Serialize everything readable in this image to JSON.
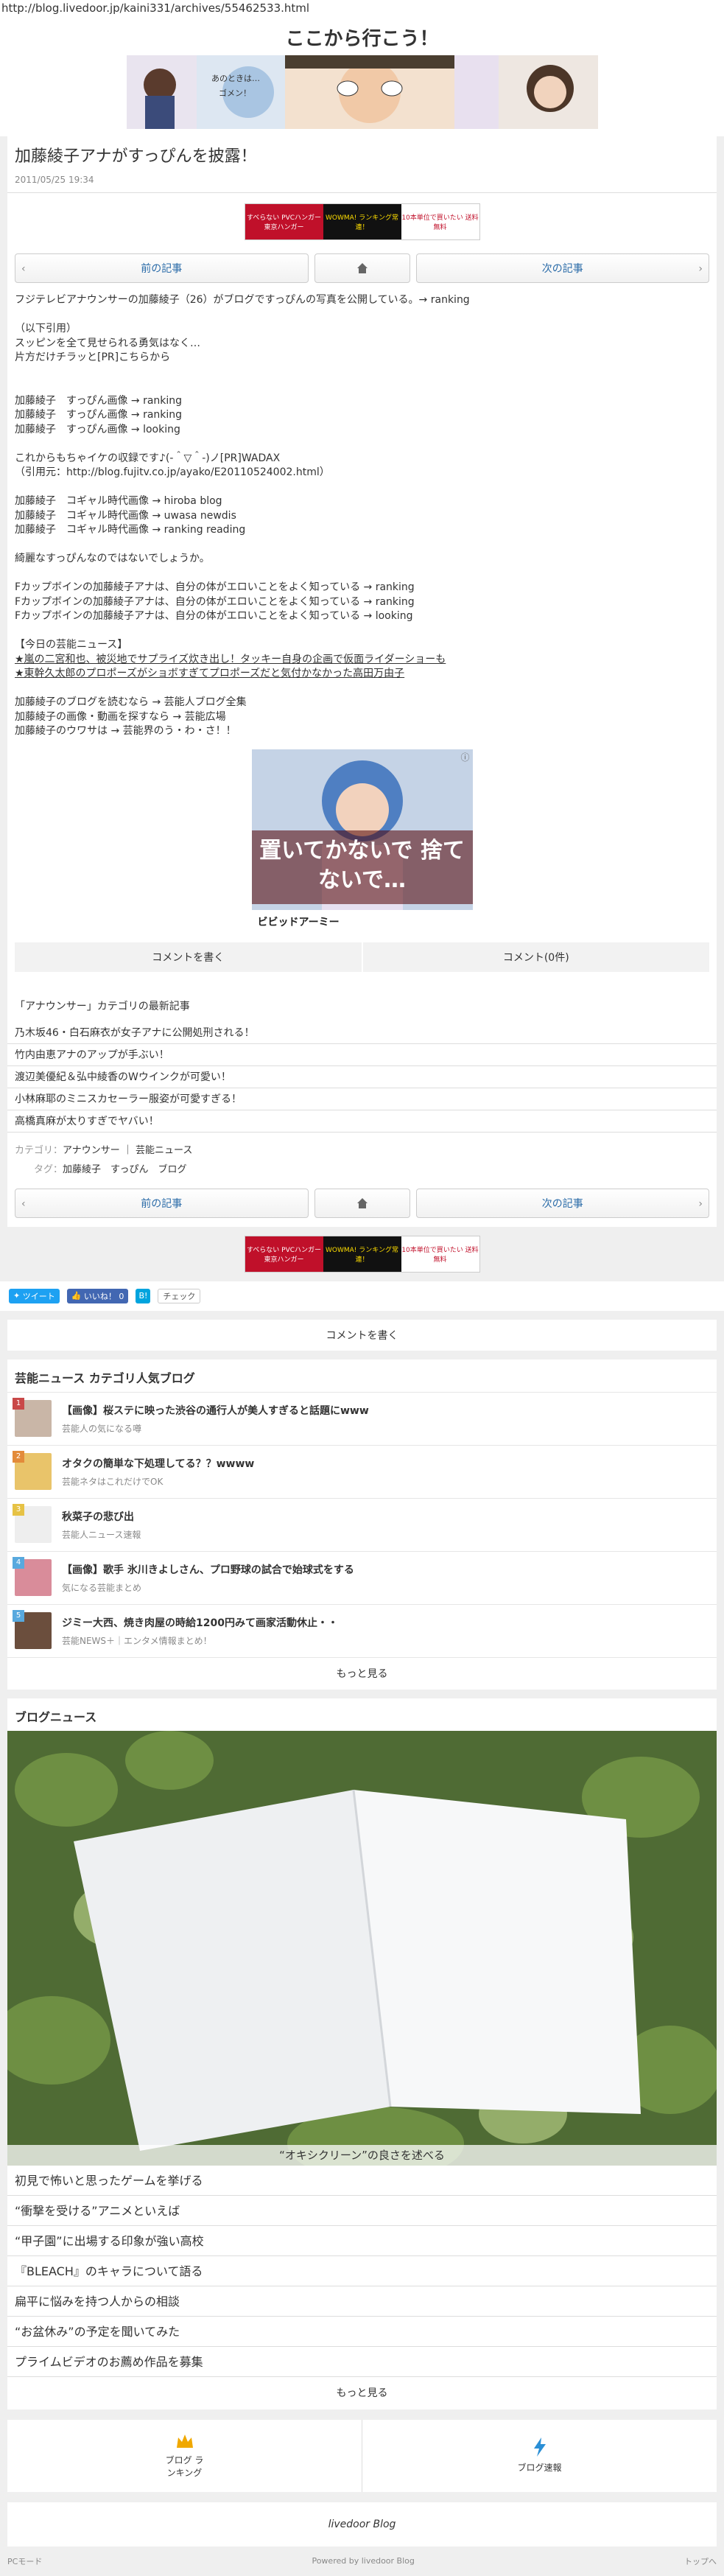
{
  "browser": {
    "url": "http://blog.livedoor.jp/kaini331/archives/55462533.html"
  },
  "site": {
    "title": "ここから行こう！"
  },
  "article": {
    "title": "加藤綾子アナがすっぴんを披露！",
    "date": "2011/05/25 19:34"
  },
  "pager": {
    "prev": "前の記事",
    "next": "次の記事"
  },
  "body": {
    "lines": [
      "フジテレビアナウンサーの加藤綾子（26）がブログですっぴんの写真を公開している。→ ranking",
      "",
      "（以下引用）",
      "スッピンを全て見せられる勇気はなく…",
      "片方だけチラッと[PR]こちらから",
      "",
      "",
      "加藤綾子　すっぴん画像 → ranking",
      "加藤綾子　すっぴん画像 → ranking",
      "加藤綾子　すっぴん画像 → looking",
      "",
      "これからもちゃイケの収録です♪(‐＾▽＾‐)ノ[PR]WADAX",
      "（引用元：http://blog.fujitv.co.jp/ayako/E20110524002.html）",
      "",
      "加藤綾子　コギャル時代画像 → hiroba blog",
      "加藤綾子　コギャル時代画像 → uwasa newdis",
      "加藤綾子　コギャル時代画像 → ranking reading",
      "",
      "綺麗なすっぴんなのではないでしょうか。",
      "",
      "Fカップボインの加藤綾子アナは、自分の体がエロいことをよく知っている → ranking",
      "Fカップボインの加藤綾子アナは、自分の体がエロいことをよく知っている → ranking",
      "Fカップボインの加藤綾子アナは、自分の体がエロいことをよく知っている → looking",
      "",
      "【今日の芸能ニュース】",
      "★嵐の二宮和也、被災地でサプライズ炊き出し！タッキー自身の企画で仮面ライダーショーも",
      "★東幹久太郎のプロポーズがショボすぎてプロポーズだと気付かなかった高田万由子",
      "",
      "加藤綾子のブログを読むなら → 芸能人ブログ全集",
      "加藤綾子の画像・動画を探すなら → 芸能広場",
      "加藤綾子のウワサは → 芸能界のう・わ・さ！！"
    ]
  },
  "ads": {
    "top_banner": [
      "すべらない PVCハンガー 東京ハンガー",
      "WOWMA! ランキング常連！",
      "10本単位で買いたい 送料無料"
    ],
    "magazine_text": "置いてかないで 捨てないで…",
    "magazine_footer": "ビビッドアーミー",
    "ad_mark": "ⓘ"
  },
  "comments": {
    "write": "コメントを書く",
    "count": "コメント(0件)"
  },
  "category": {
    "heading": "「アナウンサー」カテゴリの最新記事",
    "items": [
      "乃木坂46・白石麻衣が女子アナに公開処刑される！",
      "竹内由恵アナのアップが手ぶい！",
      "渡辺美優紀＆弘中綾香のWウインクが可愛い！",
      "小林麻耶のミニスカセーラー服姿が可愛すぎる！",
      "高橋真麻が太りすぎでヤバい！"
    ],
    "category_label": "カテゴリ：",
    "categories": "アナウンサー ｜ 芸能ニュース",
    "tag_label": "タグ：",
    "tags": "加藤綾子　すっぴん　ブログ"
  },
  "social": {
    "tweet": "ツイート",
    "like": "いいね！ 0",
    "hatena": "B!",
    "mixi": "チェック"
  },
  "comment_bar": "コメントを書く",
  "ranking": {
    "title": "芸能ニュース カテゴリ人気ブログ",
    "items": [
      {
        "num": "1",
        "title": "【画像】桜ステに映った渋谷の通行人が美人すぎると話題にwww",
        "sub": "芸能人の気になる噂",
        "color": "#c94848"
      },
      {
        "num": "2",
        "title": "オタクの簡単な下処理してる？？wwww",
        "sub": "芸能ネタはこれだけでOK",
        "color": "#e38b3a"
      },
      {
        "num": "3",
        "title": "秋菜子の悲び出",
        "sub": "芸能人ニュース速報",
        "color": "#e6c245"
      },
      {
        "num": "4",
        "title": "【画像】歌手 氷川きよしさん、プロ野球の試合で始球式をする",
        "sub": "気になる芸能まとめ",
        "color": "#58a9de"
      },
      {
        "num": "5",
        "title": "ジミー大西、焼き肉屋の時給1200円みて画家活動休止・・",
        "sub": "芸能NEWS＋｜エンタメ情報まとめ！",
        "color": "#58a9de"
      }
    ],
    "more": "もっと見る"
  },
  "blog_news": {
    "title": "ブログニュース",
    "caption": "“オキシクリーン”の良さを述べる",
    "items": [
      "初見で怖いと思ったゲームを挙げる",
      "“衝撃を受ける”アニメといえば",
      "“甲子園”に出場する印象が強い高校",
      "『BLEACH』のキャラについて語る",
      "扁平に悩みを持つ人からの相談",
      "“お盆休み”の予定を聞いてみた",
      "プライムビデオのお薦め作品を募集"
    ],
    "more": "もっと見る"
  },
  "footer": {
    "ranking_label": "ブログ ランキング",
    "news_label": "ブログ速報",
    "brand": "livedoor Blog",
    "pc_mode": "PCモード",
    "powered": "Powered by livedoor Blog",
    "top": "トップへ"
  }
}
